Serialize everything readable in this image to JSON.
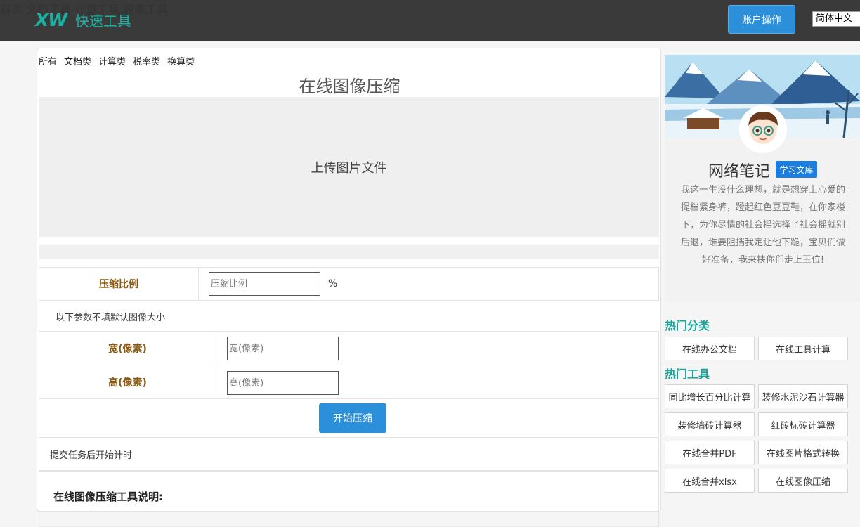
{
  "header": {
    "logo_mark": "XW",
    "logo_text": "快速工具",
    "nav": [
      "首页",
      "文档工具",
      "计算工具",
      "税率工具"
    ],
    "account_button": "账户操作",
    "language": "简体中文"
  },
  "main": {
    "categories": [
      "所有",
      "文档类",
      "计算类",
      "税率类",
      "换算类"
    ],
    "title": "在线图像压缩",
    "upload_label": "上传图片文件",
    "ratio": {
      "label": "压缩比例",
      "placeholder": "压缩比例",
      "unit": "%"
    },
    "note": "以下参数不填默认图像大小",
    "width": {
      "label": "宽(像素)",
      "placeholder": "宽(像素)"
    },
    "height": {
      "label": "高(像素)",
      "placeholder": "高(像素)"
    },
    "start_button": "开始压缩",
    "timer_text": "提交任务后开始计时",
    "desc_title": "在线图像压缩工具说明:"
  },
  "profile": {
    "name": "网络笔记",
    "badge": "学习文库",
    "bio": "我这一生没什么理想，就是想穿上心爱的提档紧身裤，蹬起红色豆豆鞋，在你家楼下，为你尽情的社会摇选择了社会摇就别后退，谁要阻挡我定让他下跪，宝贝们做好准备，我来扶你们走上王位!"
  },
  "hot_categories": {
    "title": "热门分类",
    "items": [
      "在线办公文档",
      "在线工具计算"
    ]
  },
  "hot_tools": {
    "title": "热门工具",
    "items": [
      "同比增长百分比计算",
      "装修水泥沙石计算器",
      "装修墙砖计算器",
      "红砖标砖计算器",
      "在线合并PDF",
      "在线图片格式转换",
      "在线合并xlsx",
      "在线图像压缩"
    ]
  },
  "colors": {
    "header_bg": "#3a3a3a",
    "brand": "#17b3a3",
    "primary_button": "#2b90d9",
    "label_brown": "#8a5a14",
    "section_teal": "#1aa39a",
    "badge_blue": "#1a7ee0"
  }
}
